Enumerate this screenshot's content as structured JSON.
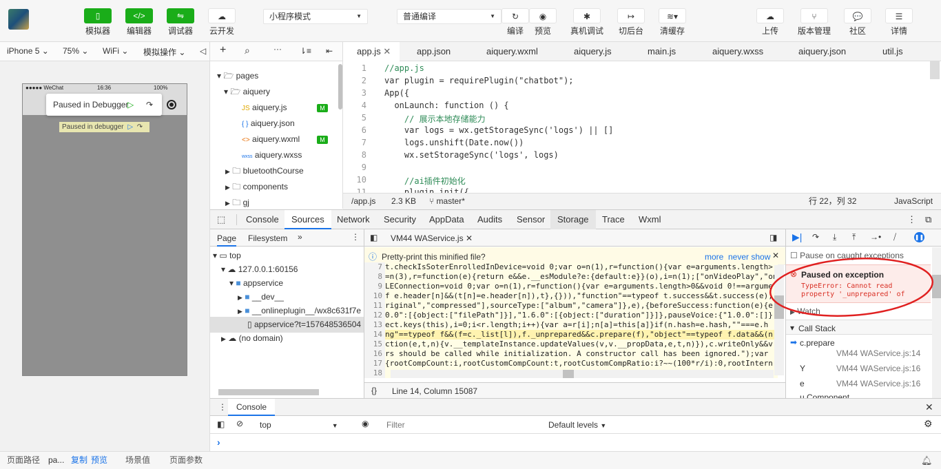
{
  "toolbar": {
    "buttons": [
      {
        "label": "模拟器",
        "icon": "phone-icon"
      },
      {
        "label": "编辑器",
        "icon": "code-icon"
      },
      {
        "label": "调试器",
        "icon": "debug-icon"
      },
      {
        "label": "云开发",
        "icon": "cloud-dev-icon"
      }
    ],
    "mode_select": "小程序模式",
    "compile_select": "普通编译",
    "actions": [
      {
        "label": "编译",
        "icon": "refresh-icon"
      },
      {
        "label": "预览",
        "icon": "eye-icon"
      },
      {
        "label": "真机调试",
        "icon": "bug-icon"
      },
      {
        "label": "切后台",
        "icon": "background-icon"
      },
      {
        "label": "清缓存",
        "icon": "layers-icon"
      }
    ],
    "right_actions": [
      {
        "label": "上传",
        "icon": "upload-cloud-icon"
      },
      {
        "label": "版本管理",
        "icon": "branch-icon"
      },
      {
        "label": "社区",
        "icon": "chat-icon"
      },
      {
        "label": "详情",
        "icon": "menu-icon"
      }
    ]
  },
  "simulator": {
    "device": "iPhone 5",
    "zoom": "75%",
    "network": "WiFi",
    "ops": "模拟操作",
    "status_carrier": "●●●●● WeChat",
    "status_time": "16:36",
    "status_battery": "100%",
    "popup_label": "Paused in Debugger",
    "badge_label": "Paused in debugger"
  },
  "filetree": [
    {
      "label": "pages",
      "type": "folder-open",
      "depth": 0
    },
    {
      "label": "aiquery",
      "type": "folder-open",
      "depth": 1
    },
    {
      "label": "aiquery.js",
      "type": "js",
      "depth": 2,
      "badge": "M"
    },
    {
      "label": "aiquery.json",
      "type": "json",
      "depth": 2
    },
    {
      "label": "aiquery.wxml",
      "type": "wxml",
      "depth": 2,
      "badge": "M"
    },
    {
      "label": "aiquery.wxss",
      "type": "wxss",
      "depth": 2
    },
    {
      "label": "bluetoothCourse",
      "type": "folder",
      "depth": 1
    },
    {
      "label": "components",
      "type": "folder",
      "depth": 1
    },
    {
      "label": "gj",
      "type": "folder",
      "depth": 1
    }
  ],
  "editor_tabs": [
    "app.js",
    "app.json",
    "aiquery.wxml",
    "aiquery.js",
    "main.js",
    "aiquery.wxss",
    "aiquery.json",
    "util.js"
  ],
  "code_lines": [
    {
      "n": "1",
      "t": "//app.js"
    },
    {
      "n": "2",
      "t": "var plugin = requirePlugin(\"chatbot\");"
    },
    {
      "n": "3",
      "t": "App({"
    },
    {
      "n": "4",
      "t": "  onLaunch: function () {"
    },
    {
      "n": "5",
      "t": "    // 展示本地存储能力"
    },
    {
      "n": "6",
      "t": "    var logs = wx.getStorageSync('logs') || []"
    },
    {
      "n": "7",
      "t": "    logs.unshift(Date.now())"
    },
    {
      "n": "8",
      "t": "    wx.setStorageSync('logs', logs)"
    },
    {
      "n": "9",
      "t": ""
    },
    {
      "n": "10",
      "t": "    //ai插件初始化"
    },
    {
      "n": "11",
      "t": "    plugin.init({"
    }
  ],
  "editor_status": {
    "path": "/app.js",
    "size": "2.3 KB",
    "branch": "master*",
    "position": "行 22，列 32",
    "language": "JavaScript"
  },
  "devtools_tabs": [
    "Console",
    "Sources",
    "Network",
    "Security",
    "AppData",
    "Audits",
    "Sensor",
    "Storage",
    "Trace",
    "Wxml"
  ],
  "sources": {
    "nav_tabs": [
      "Page",
      "Filesystem"
    ],
    "tree": [
      {
        "label": "top",
        "depth": 0
      },
      {
        "label": "127.0.0.1:60156",
        "depth": 1
      },
      {
        "label": "appservice",
        "depth": 2
      },
      {
        "label": "__dev__",
        "depth": 3
      },
      {
        "label": "__onlineplugin__/wx8c631f7e",
        "depth": 3
      },
      {
        "label": "appservice?t=157648536504",
        "depth": 3
      },
      {
        "label": "(no domain)",
        "depth": 0
      }
    ],
    "open_file": "VM44 WAService.js",
    "pretty_print_prompt": "Pretty-print this minified file?",
    "pretty_more": "more",
    "pretty_never": "never show",
    "code_rows": [
      {
        "n": "7",
        "t": "t.checkIsSoterEnrolledInDevice=void 0;var o=n(1),r=function(){var e=arguments.length>"
      },
      {
        "n": "8",
        "t": "=n(3),r=function(e){return e&&e.__esModule?e:{default:e}}(o),i=n(1);[\"onVideoPlay\",\"on"
      },
      {
        "n": "9",
        "t": "LEConnection=void 0;var o=n(1),r=function(){var e=arguments.length>0&&void 0!==argume"
      },
      {
        "n": "10",
        "t": "f e.header[n]&&(t[n]=e.header[n]),t},{})),\"function\"==typeof t.success&&t.success(e),"
      },
      {
        "n": "11",
        "t": "riginal\",\"compressed\"],sourceType:[\"album\",\"camera\"]},e),{beforeSuccess:function(e){e"
      },
      {
        "n": "12",
        "t": "0.0\":[{object:[\"filePath\"]}],\"1.6.0\":[{object:[\"duration\"]}]},pauseVoice:{\"1.0.0\":[]}"
      },
      {
        "n": "13",
        "t": "ect.keys(this),i=0;i<r.length;i++){var a=r[i];n[a]=this[a]}if(n.hash=e.hash,\"\"===e.h"
      },
      {
        "n": "14",
        "t": "ng\"==typeof f&&(f=c._list[l]),f._unprepared&&c.prepare(f),\"object\"==typeof f.data&&(n"
      },
      {
        "n": "15",
        "t": "ction(e,t,n){v.__templateInstance.updateValues(v,v.__propData,e,t,n)}),c.writeOnly&&v"
      },
      {
        "n": "16",
        "t": "rs should be called while initialization. A constructor call has been ignored.\");var"
      },
      {
        "n": "17",
        "t": "{rootCompCount:i,rootCustomCompCount:t,rootCustomCompRatio:i?~~(100*r/i):0,rootIntern"
      },
      {
        "n": "18",
        "t": ""
      }
    ],
    "status": "Line 14, Column 15087"
  },
  "debugger": {
    "pause_on_caught": "Pause on caught exceptions",
    "exception_title": "Paused on exception",
    "exception_msg": "TypeError: Cannot read property '_unprepared' of",
    "watch": "Watch",
    "call_stack": "Call Stack",
    "frames": [
      {
        "name": "c.prepare",
        "loc": "VM44 WAService.js:14"
      },
      {
        "name": "Y",
        "loc": "VM44 WAService.js:16"
      },
      {
        "name": "e",
        "loc": "VM44 WAService.js:16"
      },
      {
        "name": "u.Component",
        "loc": ""
      }
    ]
  },
  "console": {
    "tab": "Console",
    "context": "top",
    "filter_placeholder": "Filter",
    "levels": "Default levels",
    "prompt": "›"
  },
  "bottombar": {
    "path_label": "页面路径",
    "path_value": "pa...",
    "copy": "复制",
    "preview": "预览",
    "scene": "场景值",
    "params": "页面参数"
  },
  "colors": {
    "green": "#1aad19",
    "highlight_annotation": "#e02020",
    "exception_red": "#d93025"
  }
}
